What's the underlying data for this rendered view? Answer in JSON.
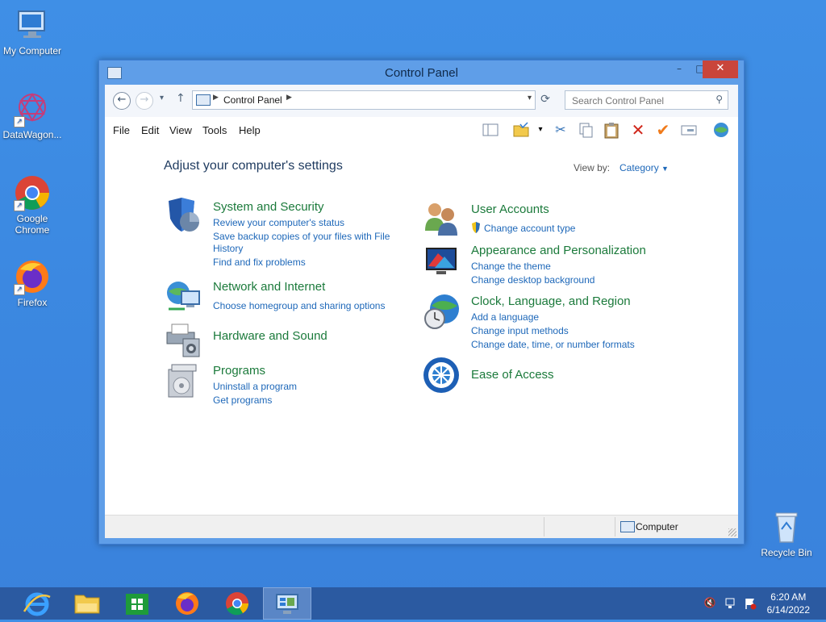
{
  "desktop": {
    "icons": [
      {
        "label": "My Computer"
      },
      {
        "label": "DataWagon..."
      },
      {
        "label": "Google Chrome"
      },
      {
        "label": "Firefox"
      },
      {
        "label": "Recycle Bin"
      }
    ]
  },
  "window": {
    "title": "Control Panel",
    "buttons": {
      "minimize": "–",
      "maximize": "□",
      "close": "✕"
    },
    "address": {
      "crumb": "Control Panel"
    },
    "search": {
      "placeholder": "Search Control Panel"
    },
    "menu": [
      "File",
      "Edit",
      "View",
      "Tools",
      "Help"
    ],
    "heading": "Adjust your computer's settings",
    "view_by_label": "View by:",
    "view_by_value": "Category",
    "left_categories": [
      {
        "title": "System and Security",
        "links": [
          "Review your computer's status",
          "Save backup copies of your files with File",
          "History",
          "Find and fix problems"
        ]
      },
      {
        "title": "Network and Internet",
        "links": [
          "Choose homegroup and sharing options"
        ]
      },
      {
        "title": "Hardware and Sound",
        "links": []
      },
      {
        "title": "Programs",
        "links": [
          "Uninstall a program",
          "Get programs"
        ]
      }
    ],
    "right_categories": [
      {
        "title": "User Accounts",
        "links": [
          "Change account type"
        ]
      },
      {
        "title": "Appearance and Personalization",
        "links": [
          "Change the theme",
          "Change desktop background"
        ]
      },
      {
        "title": "Clock, Language, and Region",
        "links": [
          "Add a language",
          "Change input methods",
          "Change date, time, or number formats"
        ]
      },
      {
        "title": "Ease of Access",
        "links": []
      }
    ],
    "status": "Computer"
  },
  "taskbar": {
    "time": "6:20 AM",
    "date": "6/14/2022"
  }
}
